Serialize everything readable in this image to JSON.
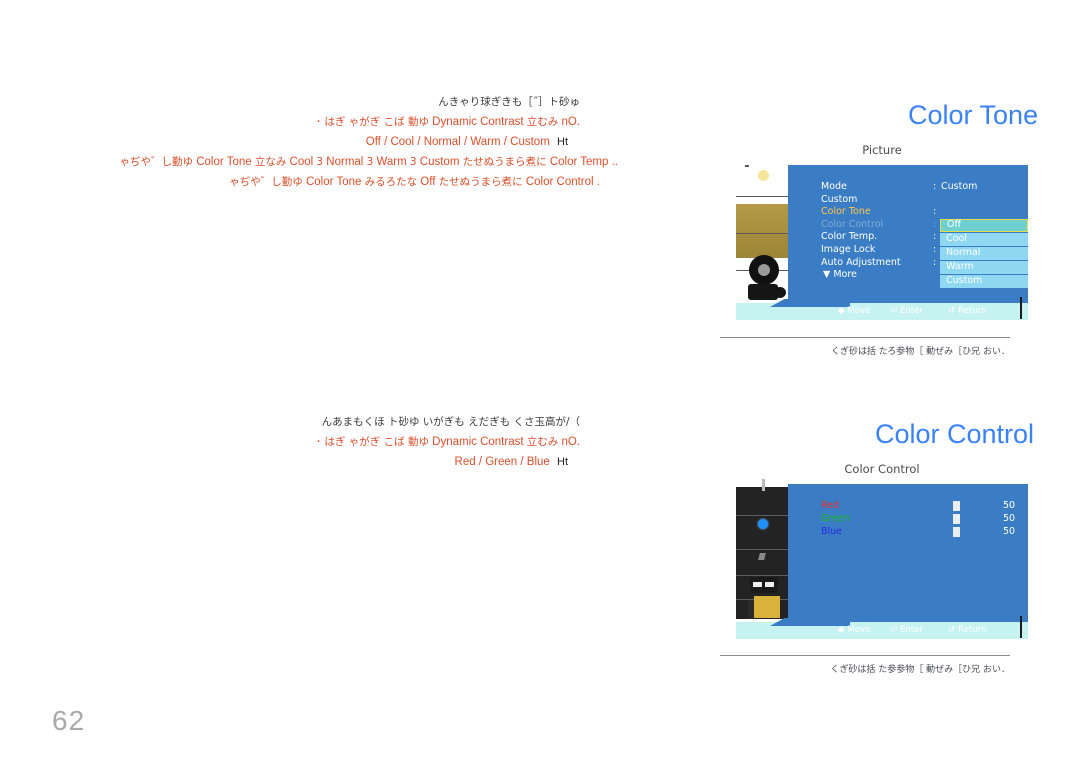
{
  "page": {
    "number": "62"
  },
  "content": {
    "section_color_tone": {
      "heading_garbled": "ゅ砂ト［˝］もきぎ球りゃきん",
      "lines": [
        {
          "marker": "",
          "garbled_tail": "ゆ動 ばこ ぎがゃ ぎは ･",
          "latin": "Dynamic Contrast",
          "garbled_lead": "みむ立",
          "prefix": ".On"
        },
        {
          "marker": "Ht",
          "options": "Off / Cool / Normal / Warm / Custom"
        },
        {
          "marker": "ゆ勤し゛やぢゃ",
          "latin_seq": "Color Tone",
          "garbled_mid": "みな立",
          "opt1": "Cool",
          "opt2": "Normal",
          "opt3": "Warm",
          "opt4": "Custom",
          "garbled_tail2": "に煮らまうぬせた",
          "latin_end": "Color Temp",
          "suffix": ".."
        },
        {
          "marker2": "ゆ勤し゛やぢゃ",
          "latin_seq2": "Color Tone",
          "garbled_mid2": "なたろるみ",
          "opt_off": "Off",
          "garbled_tail3": "に煮らまうぬせた",
          "latin_end2": "Color Control",
          "suffix2": "."
        }
      ]
    },
    "section_color_control": {
      "heading_garbled": "）/が高玉さく もぎだえ もぎがい ゆ砂ト ほくもまあん",
      "lines": [
        {
          "garbled_tail": "ゆ動 ばこ ぎがゃ ぎは ･",
          "latin": "Dynamic Contrast",
          "garbled_lead": "みむ立",
          "prefix": ".On"
        },
        {
          "marker": "Ht",
          "options": "Red / Green / Blue"
        }
      ]
    }
  },
  "figures": [
    {
      "title": "Color Tone",
      "osd_header": "Picture",
      "rows": [
        {
          "label": "Mode",
          "colon": ":",
          "value": "Custom",
          "state": "normal"
        },
        {
          "label": "Custom",
          "colon": "",
          "value": "",
          "state": "normal"
        },
        {
          "label": "Color Tone",
          "colon": ":",
          "value": "",
          "state": "active"
        },
        {
          "label": "Color Control",
          "colon": ":",
          "value": "",
          "state": "disabled"
        },
        {
          "label": "Color Temp.",
          "colon": ":",
          "value": "",
          "state": "normal"
        },
        {
          "label": "Image Lock",
          "colon": ":",
          "value": "",
          "state": "normal"
        },
        {
          "label": "Auto Adjustment",
          "colon": ":",
          "value": "",
          "state": "normal"
        }
      ],
      "more_label": "▼ More",
      "dropdown": [
        {
          "label": "Off",
          "selected": true
        },
        {
          "label": "Cool",
          "selected": false
        },
        {
          "label": "Normal",
          "selected": false
        },
        {
          "label": "Warm",
          "selected": false
        },
        {
          "label": "Custom",
          "selected": false
        }
      ],
      "hints": {
        "move": "Move",
        "enter": "Enter",
        "return": "Return"
      },
      "caption_garbled": "．くぎ砂は括 たろ参物［ 動ぜみ［ひ兄  おい"
    },
    {
      "title": "Color Control",
      "osd_header": "Color Control",
      "cc_rows": [
        {
          "label": "Red",
          "value": "50",
          "color": "#e8312a"
        },
        {
          "label": "Green",
          "value": "50",
          "color": "#19b822"
        },
        {
          "label": "Blue",
          "value": "50",
          "color": "#2a2ae0"
        }
      ],
      "hints": {
        "move": "Move",
        "enter": "Enter",
        "return": "Return"
      },
      "caption_garbled": "．くぎ砂は括 た参参物［ 動ぜみ［ひ兄  おい"
    }
  ],
  "colors": {
    "accent_blue": "#3b82f6",
    "osd_panel": "#3a7dc4",
    "osd_bar": "#c6f3f1",
    "highlight_yellow": "#ffc64a",
    "dropdown_bg": "#8fd8f2",
    "dropdown_selected_bg": "#6fd0cf",
    "dropdown_selected_border": "#e3e14a",
    "body_text": "#d94f2b"
  }
}
